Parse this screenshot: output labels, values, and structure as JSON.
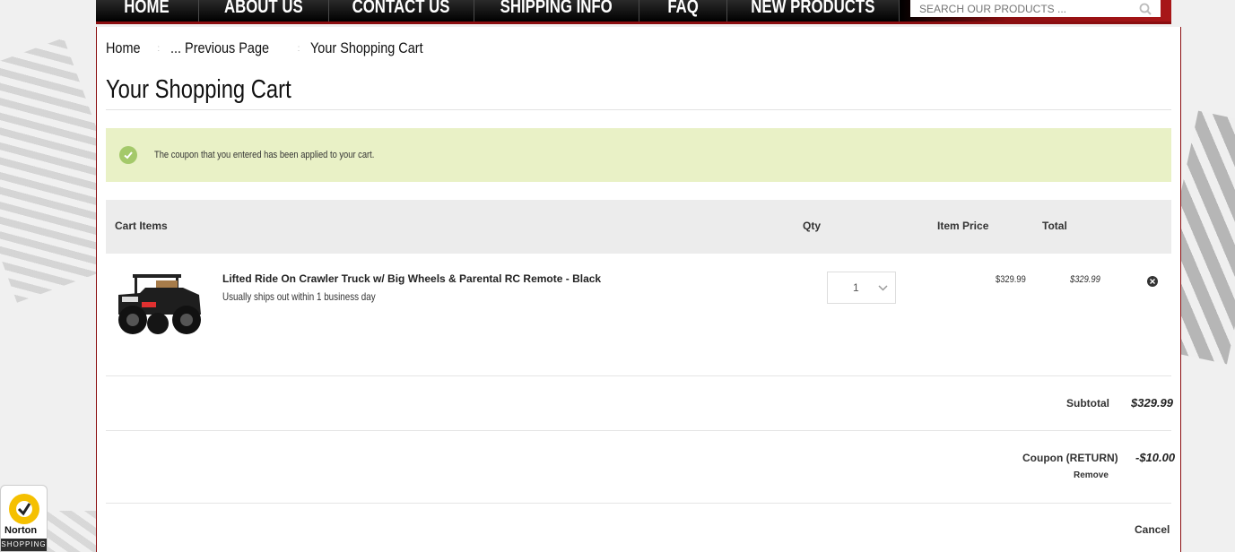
{
  "nav": {
    "items": [
      "HOME",
      "ABOUT US",
      "CONTACT US",
      "SHIPPING INFO",
      "FAQ",
      "NEW PRODUCTS"
    ],
    "search_placeholder": "SEARCH OUR PRODUCTS ..."
  },
  "breadcrumb": {
    "home": "Home",
    "previous": "... Previous Page",
    "current": "Your Shopping Cart"
  },
  "page_title": "Your Shopping Cart",
  "alert": {
    "message": "The coupon that you entered has been applied to your cart."
  },
  "cart_header": {
    "items": "Cart Items",
    "qty": "Qty",
    "item_price": "Item Price",
    "total": "Total"
  },
  "cart_items": [
    {
      "name": "Lifted Ride On Crawler Truck w/ Big Wheels & Parental RC Remote - Black",
      "shipping": "Usually ships out within 1 business day",
      "qty": "1",
      "price": "$329.99",
      "total": "$329.99"
    }
  ],
  "summary": {
    "subtotal_label": "Subtotal",
    "subtotal_value": "$329.99",
    "coupon_label": "Coupon (RETURN)",
    "coupon_value": "-$10.00",
    "coupon_remove": "Remove",
    "cancel": "Cancel"
  },
  "norton": {
    "name": "Norton",
    "tagline": "SHOPPING"
  },
  "colors": {
    "accent": "#8b0e10",
    "alert_bg": "#e9f1c6",
    "check": "#a4c96a"
  }
}
